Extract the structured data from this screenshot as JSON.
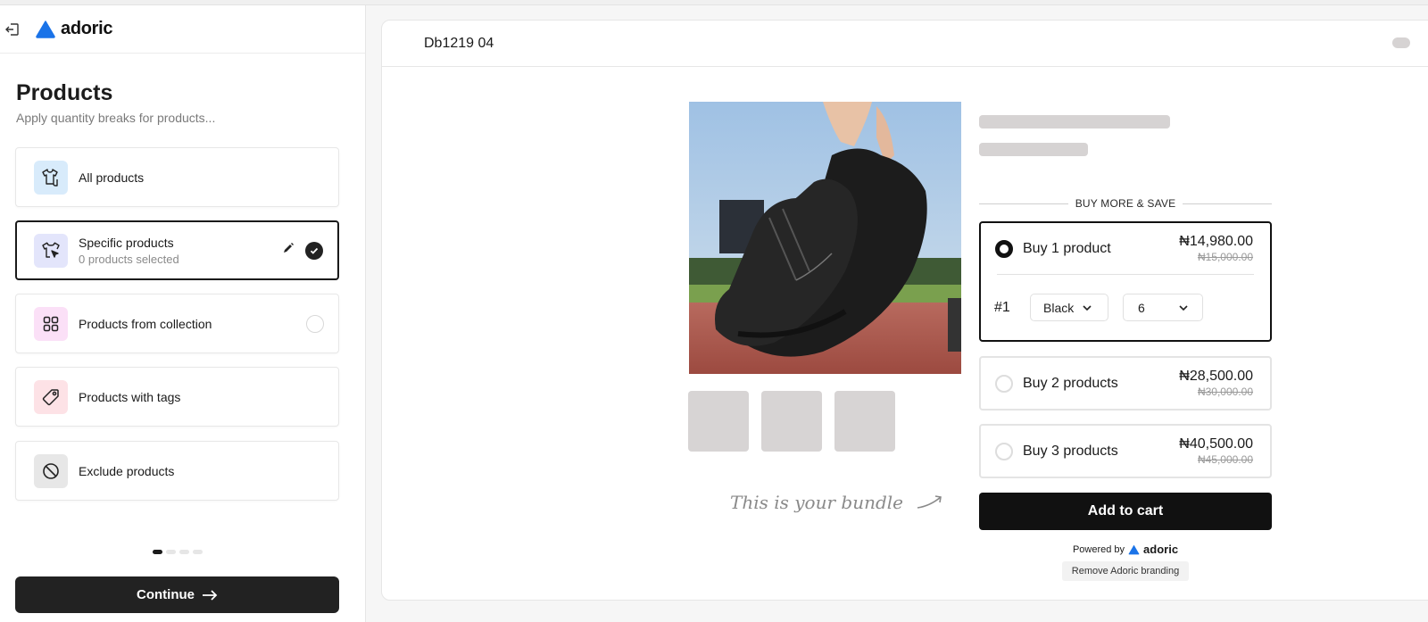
{
  "app": {
    "brand": "adoric",
    "brand_color": "#1a73e8"
  },
  "sidebar": {
    "title": "Products",
    "subtitle": "Apply quantity breaks for products...",
    "options": [
      {
        "label": "All products",
        "sublabel": null,
        "icon": "shirt-icon",
        "icon_bg": "#d8ebfb",
        "state": "none"
      },
      {
        "label": "Specific products",
        "sublabel": "0 products selected",
        "icon": "shirt-cursor-icon",
        "icon_bg": "#e3e5fb",
        "state": "selected"
      },
      {
        "label": "Products from collection",
        "sublabel": null,
        "icon": "grid-icon",
        "icon_bg": "#fbe0f7",
        "state": "radio"
      },
      {
        "label": "Products with tags",
        "sublabel": null,
        "icon": "tag-icon",
        "icon_bg": "#fde2e6",
        "state": "none"
      },
      {
        "label": "Exclude products",
        "sublabel": null,
        "icon": "ban-icon",
        "icon_bg": "#e7e7e7",
        "state": "none"
      }
    ],
    "steps": {
      "current": 1,
      "total": 4
    },
    "continue_label": "Continue"
  },
  "preview": {
    "title": "Db1219 04",
    "bundle_note": "This is your bundle",
    "section_label": "BUY MORE & SAVE",
    "tiers": [
      {
        "label": "Buy 1 product",
        "price": "₦14,980.00",
        "compare_price": "₦15,000.00",
        "selected": true,
        "variants": [
          {
            "index": "#1",
            "color": "Black",
            "size": "6"
          }
        ]
      },
      {
        "label": "Buy 2 products",
        "price": "₦28,500.00",
        "compare_price": "₦30,000.00",
        "selected": false
      },
      {
        "label": "Buy 3 products",
        "price": "₦40,500.00",
        "compare_price": "₦45,000.00",
        "selected": false
      }
    ],
    "add_to_cart_label": "Add to cart",
    "powered_by_label": "Powered by",
    "powered_brand": "adoric",
    "remove_branding_label": "Remove Adoric branding"
  }
}
